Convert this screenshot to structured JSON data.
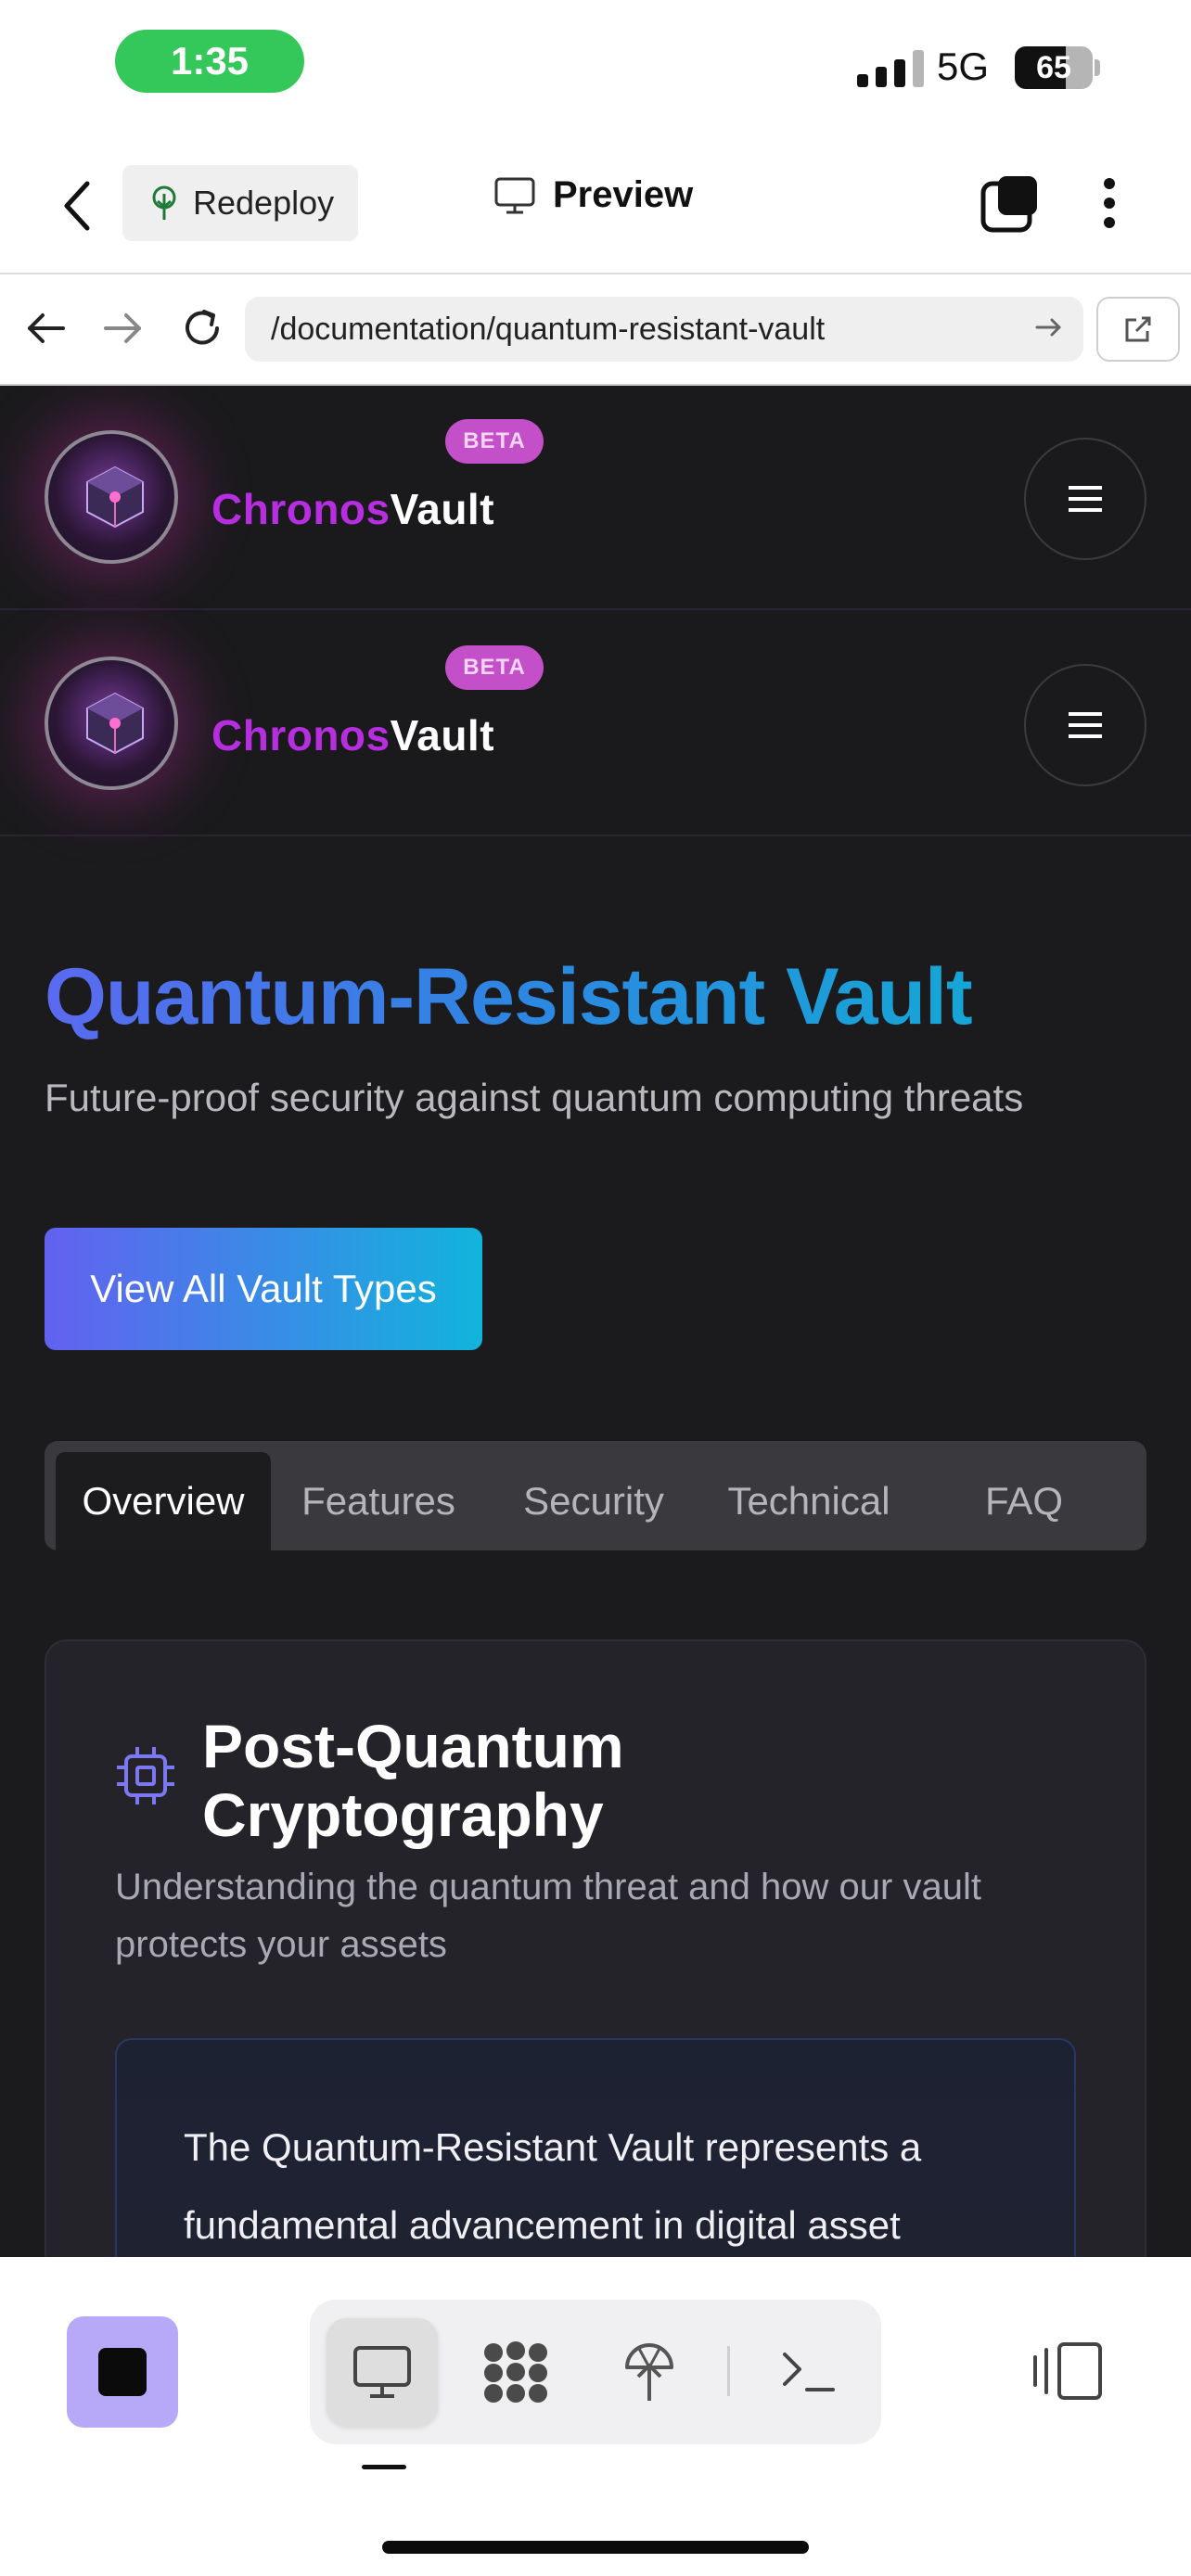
{
  "status_bar": {
    "time": "1:35",
    "network": "5G",
    "battery_level": "65",
    "battery_fraction": 0.65,
    "time_pill_color": "#34c759"
  },
  "app_toolbar": {
    "back_icon": "chevron-left-icon",
    "redeploy_label": "Redeploy",
    "redeploy_icon": "deploy-tree-icon",
    "preview_label": "Preview",
    "preview_icon": "monitor-icon",
    "tabs_icon": "tabs-icon",
    "more_icon": "more-vertical-icon"
  },
  "url_bar": {
    "url": "/documentation/quantum-resistant-vault"
  },
  "site": {
    "brand_part1": "Chronos",
    "brand_part2": "Vault",
    "beta_badge": "BETA",
    "accent_purple": "#b72ee0",
    "beta_color": "#c34fc9"
  },
  "hero": {
    "title": "Quantum-Resistant Vault",
    "subtitle": "Future-proof security against quantum computing threats",
    "cta_label": "View All Vault Types"
  },
  "tabs": [
    {
      "label": "Overview",
      "active": true
    },
    {
      "label": "Features",
      "active": false
    },
    {
      "label": "Security",
      "active": false
    },
    {
      "label": "Technical",
      "active": false
    },
    {
      "label": "FAQ",
      "active": false
    }
  ],
  "card": {
    "icon": "cpu-chip-icon",
    "title": "Post-Quantum Cryptography",
    "description": "Understanding the quantum threat and how our vault protects your assets",
    "body": "The Quantum-Resistant Vault represents a fundamental advancement in digital asset"
  },
  "bottom_bar": {
    "stop_color": "#b8a9f8",
    "items": [
      "monitor-icon",
      "network-icon",
      "deploy-icon",
      "terminal-icon"
    ],
    "side_icon": "panels-icon"
  }
}
